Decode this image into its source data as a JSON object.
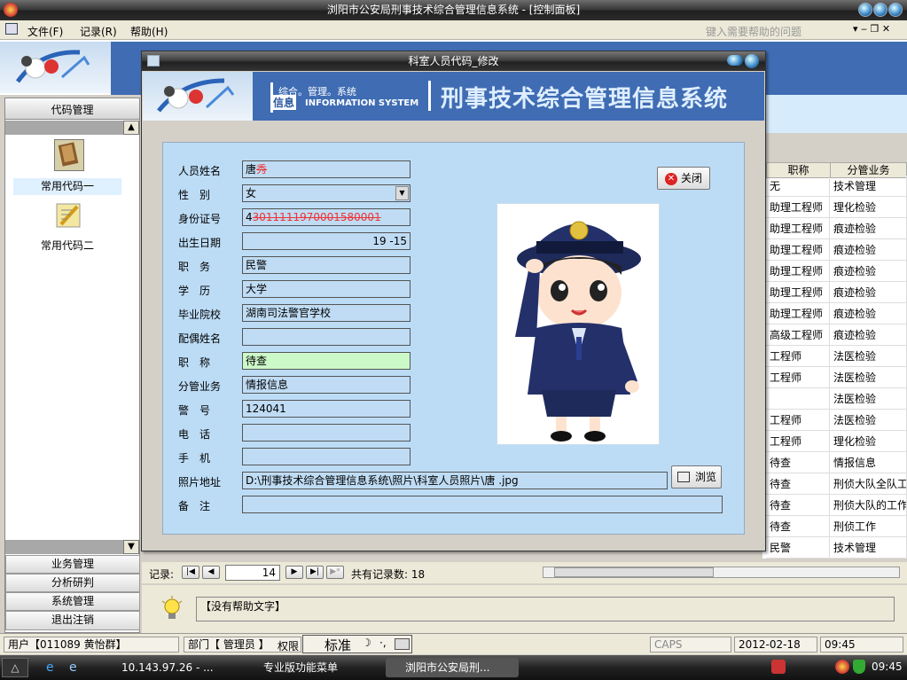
{
  "window": {
    "title": "浏阳市公安局刑事技术综合管理信息系统 - [控制面板]"
  },
  "menu": {
    "items": [
      "文件(F)",
      "记录(R)",
      "帮助(H)"
    ],
    "help_placeholder": "键入需要帮助的问题"
  },
  "sidebar": {
    "header": "代码管理",
    "items": [
      "常用代码一",
      "常用代码二"
    ],
    "nav": [
      "业务管理",
      "分析研判",
      "系统管理",
      "退出注销"
    ]
  },
  "grid": {
    "columns": [
      "职称",
      "分管业务"
    ],
    "rows": [
      [
        "无",
        "技术管理"
      ],
      [
        "助理工程师",
        "理化检验"
      ],
      [
        "助理工程师",
        "痕迹检验"
      ],
      [
        "助理工程师",
        "痕迹检验"
      ],
      [
        "助理工程师",
        "痕迹检验"
      ],
      [
        "助理工程师",
        "痕迹检验"
      ],
      [
        "助理工程师",
        "痕迹检验"
      ],
      [
        "高级工程师",
        "痕迹检验"
      ],
      [
        "工程师",
        "法医检验"
      ],
      [
        "工程师",
        "法医检验"
      ],
      [
        "",
        "法医检验"
      ],
      [
        "工程师",
        "法医检验"
      ],
      [
        "工程师",
        "理化检验"
      ],
      [
        "待查",
        "情报信息"
      ],
      [
        "待查",
        "刑侦大队全队工"
      ],
      [
        "待查",
        "刑侦大队的工作"
      ],
      [
        "待查",
        "刑侦工作"
      ],
      [
        "民警",
        "技术管理"
      ]
    ]
  },
  "record_bar": {
    "label": "记录:",
    "current": "14",
    "total_label": "共有记录数: 18"
  },
  "help_bar": {
    "text": "【没有帮助文字】"
  },
  "status": {
    "user": "用户【011089 黄怡群】",
    "dept": "部门【 管理员 】",
    "perm": "权限",
    "ime": "标准",
    "caps": "CAPS",
    "date": "2012-02-18",
    "time": "09:45"
  },
  "taskbar": {
    "tasks": [
      "10.143.97.26 - ...",
      "专业版功能菜单",
      "浏阳市公安局刑..."
    ],
    "clock": "09:45"
  },
  "dialog": {
    "title": "科室人员代码_修改",
    "brand_line1": "综合。管理。系统",
    "brand_badge": "信息",
    "brand_line2": "INFORMATION SYSTEM",
    "banner_title": "刑事技术综合管理信息系统",
    "close_label": "关闭",
    "browse_label": "浏览",
    "fields": {
      "name": {
        "label": "人员姓名",
        "value": "唐"
      },
      "gender": {
        "label": "性　别",
        "value": "女"
      },
      "id_no": {
        "label": "身份证号",
        "value": "4"
      },
      "birth": {
        "label": "出生日期",
        "value": "19 -15"
      },
      "duty": {
        "label": "职　务",
        "value": "民警"
      },
      "edu": {
        "label": "学　历",
        "value": "大学"
      },
      "school": {
        "label": "毕业院校",
        "value": "湖南司法警官学校"
      },
      "spouse": {
        "label": "配偶姓名",
        "value": ""
      },
      "title": {
        "label": "职　称",
        "value": "待查"
      },
      "business": {
        "label": "分管业务",
        "value": "情报信息"
      },
      "badge": {
        "label": "警　号",
        "value": "124041"
      },
      "phone": {
        "label": "电　话",
        "value": ""
      },
      "mobile": {
        "label": "手　机",
        "value": ""
      },
      "photo_path": {
        "label": "照片地址",
        "value": "D:\\刑事技术综合管理信息系统\\照片\\科室人员照片\\唐 .jpg"
      },
      "remark": {
        "label": "备　注",
        "value": ""
      }
    }
  }
}
